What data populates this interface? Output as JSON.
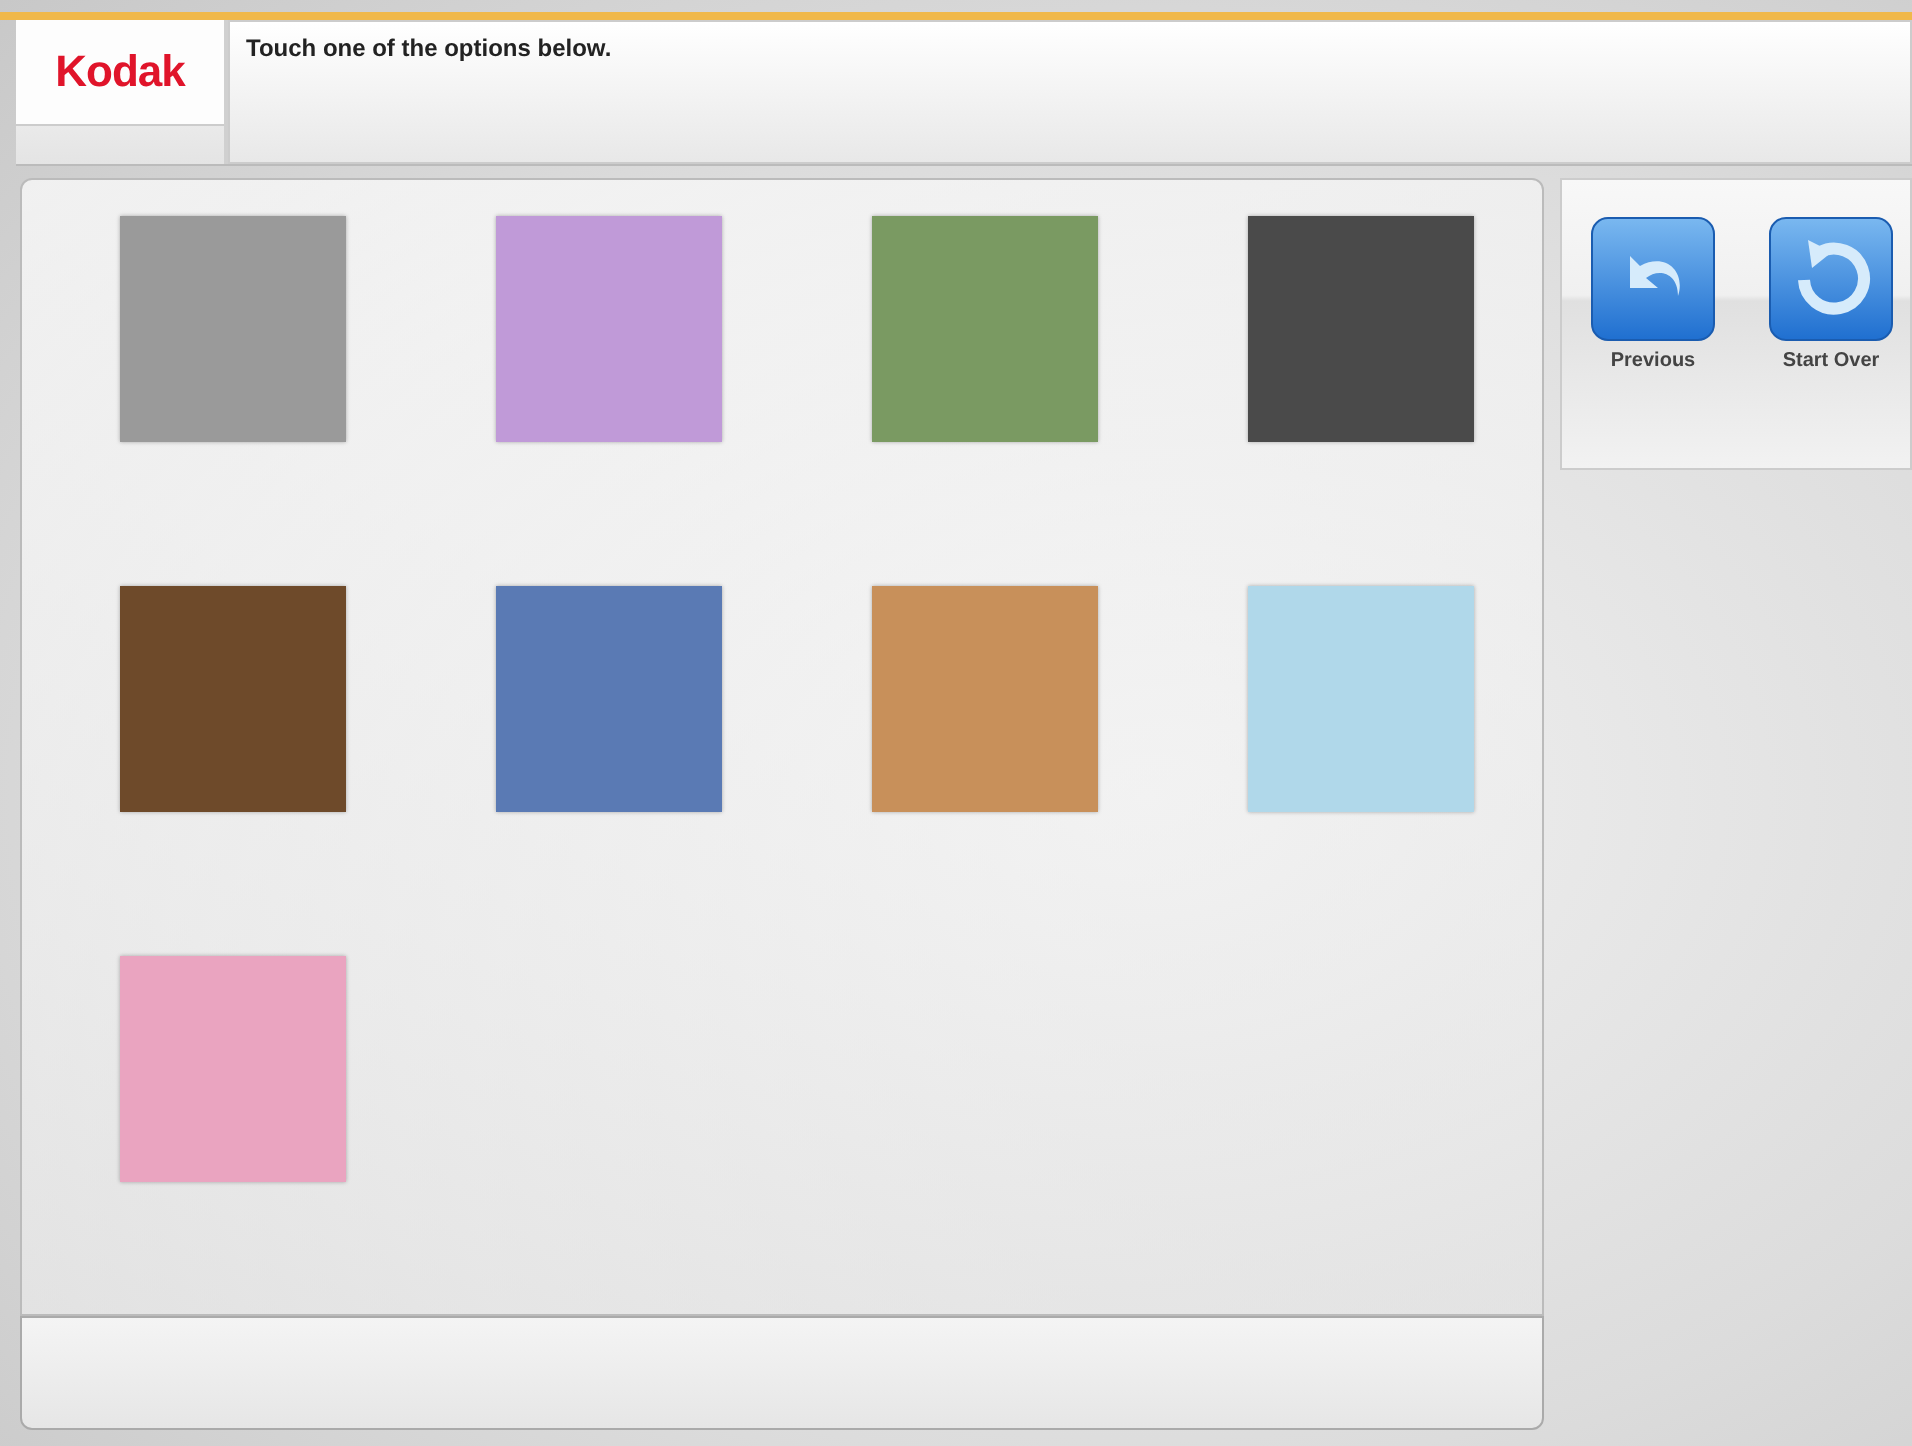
{
  "header": {
    "logo": "Kodak",
    "message": "Touch one of the options below."
  },
  "swatches": [
    {
      "color": "#9a9a9a"
    },
    {
      "color": "#c09ad8"
    },
    {
      "color": "#7a9a62"
    },
    {
      "color": "#4a4a4a"
    },
    {
      "color": "#6e4a2a"
    },
    {
      "color": "#5a7ab4"
    },
    {
      "color": "#c8905a"
    },
    {
      "color": "#b0d8ea"
    },
    {
      "color": "#eaa4c0"
    }
  ],
  "nav_buttons": [
    {
      "kind": "previous",
      "label": "Previous"
    },
    {
      "kind": "start_over",
      "label": "Start Over"
    }
  ]
}
